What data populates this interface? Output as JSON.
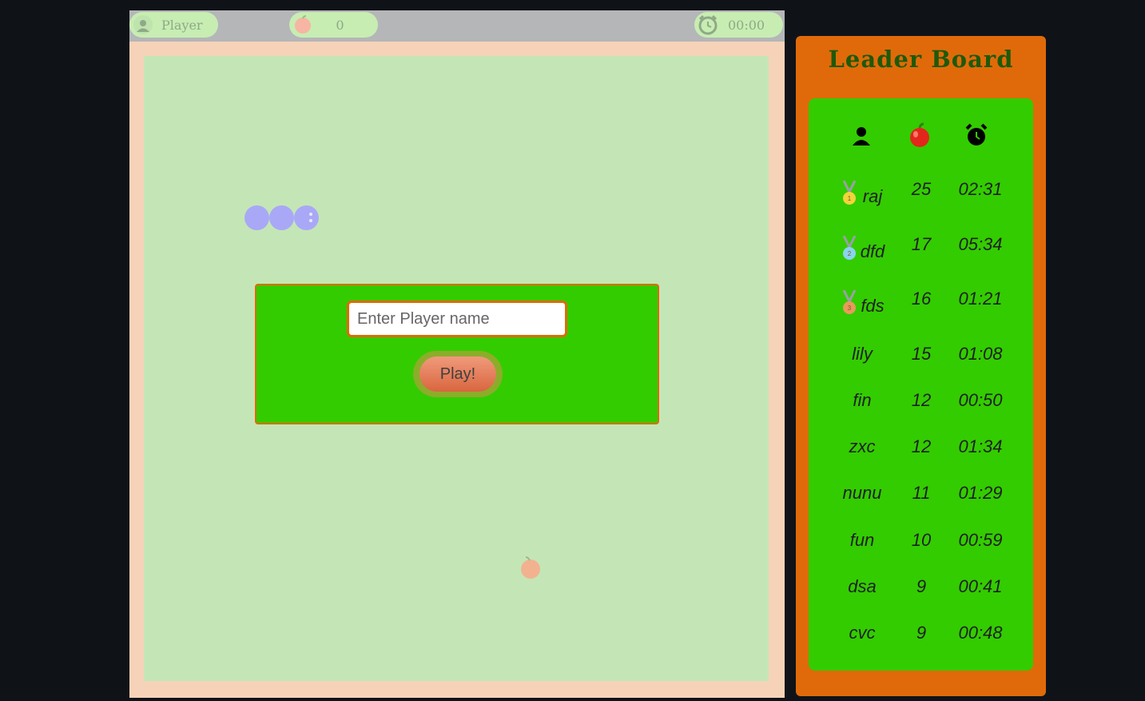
{
  "status_bar": {
    "player_label": "Player",
    "player_icon": "user-icon",
    "score": "0",
    "score_icon": "apple-icon",
    "time": "00:00",
    "time_icon": "alarm-clock-icon"
  },
  "start_dialog": {
    "name_placeholder": "Enter Player name",
    "name_value": "",
    "play_label": "Play!"
  },
  "leaderboard": {
    "title": "Leader Board",
    "columns": [
      {
        "icon": "user-icon"
      },
      {
        "icon": "apple-icon"
      },
      {
        "icon": "alarm-clock-icon"
      }
    ],
    "rows": [
      {
        "name": "raj",
        "score": "25",
        "time": "02:31",
        "medal": "1"
      },
      {
        "name": "dfd",
        "score": "17",
        "time": "05:34",
        "medal": "2"
      },
      {
        "name": "fds",
        "score": "16",
        "time": "01:21",
        "medal": "3"
      },
      {
        "name": "lily",
        "score": "15",
        "time": "01:08"
      },
      {
        "name": "fin",
        "score": "12",
        "time": "00:50"
      },
      {
        "name": "zxc",
        "score": "12",
        "time": "01:34"
      },
      {
        "name": "nunu",
        "score": "11",
        "time": "01:29"
      },
      {
        "name": "fun",
        "score": "10",
        "time": "00:59"
      },
      {
        "name": "dsa",
        "score": "9",
        "time": "00:41"
      },
      {
        "name": "cvc",
        "score": "9",
        "time": "00:48"
      }
    ]
  },
  "colors": {
    "page_background": "#0f1318",
    "board": "#c4e6b6",
    "board_border": "#f6d3b8",
    "dialog": "#33cc00",
    "accent_orange": "#e06a0a",
    "snake": "#a9a8f7",
    "leaderboard_title": "#1d5a0a"
  }
}
